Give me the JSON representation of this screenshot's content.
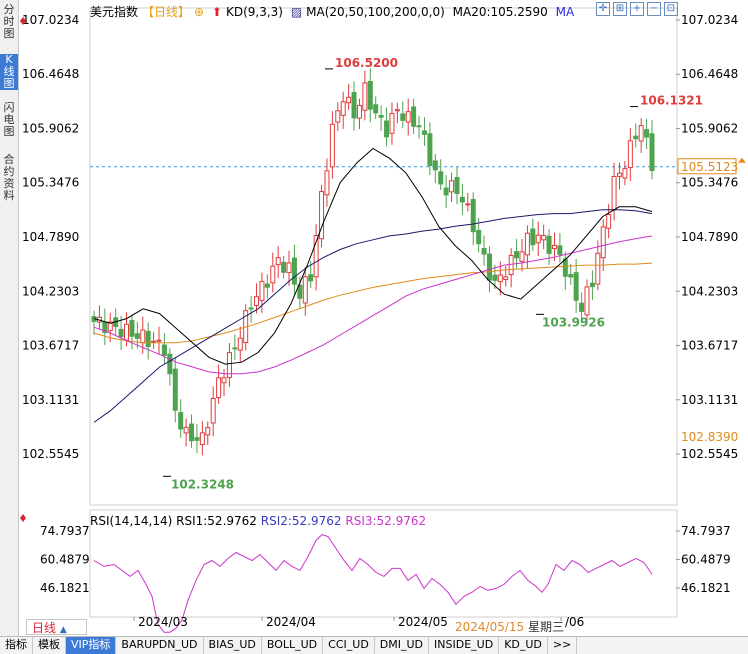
{
  "left_tabs": [
    {
      "label": "分时图",
      "active": false
    },
    {
      "label": "K线图",
      "active": true
    },
    {
      "label": "闪电图",
      "active": false
    },
    {
      "label": "合约资料",
      "active": false
    }
  ],
  "legend": {
    "symbol": "美元指数",
    "period": "【日线】",
    "kd": "KD(9,3,3)",
    "ma": "MA(20,50,100,200,0,0)",
    "ma20_value": "MA20:105.2590",
    "ma_label": "MA"
  },
  "colors": {
    "up": "#e03c3c",
    "down": "#4fa34f",
    "ma20": "#000000",
    "ma50": "#1a1a6e",
    "ma100": "#cc33cc",
    "ma200": "#e08a1a",
    "rsi": "#cc33cc",
    "accent": "#3d7ad6"
  },
  "price_axis": {
    "ticks": [
      "107.0234",
      "106.4648",
      "105.9062",
      "105.3476",
      "104.7890",
      "104.2303",
      "103.6717",
      "103.1131",
      "102.5545"
    ]
  },
  "price_markers": {
    "current": "105.5123",
    "lower_ref": "102.8390"
  },
  "annotations": {
    "high1": "106.5200",
    "high2": "106.1321",
    "low1": "102.3248",
    "low2": "103.9926"
  },
  "rsi": {
    "legend_name": "RSI(14,14,14)",
    "rsi1": "RSI1:52.9762",
    "rsi2": "RSI2:52.9762",
    "rsi3": "RSI3:52.9762",
    "ticks": [
      "74.7937",
      "60.4879",
      "46.1821"
    ]
  },
  "x_axis": {
    "labels": [
      "2024/03",
      "2024/04",
      "2024/05",
      "/06"
    ]
  },
  "period_selector": "日线",
  "cursor_date": {
    "date": "2024/05/15",
    "weekday": "星期三"
  },
  "bottom_tabs": [
    "指标",
    "模板",
    "VIP指标",
    "BARUPDN_UD",
    "BIAS_UD",
    "BOLL_UD",
    "CCI_UD",
    "DMI_UD",
    "INSIDE_UD",
    "KD_UD",
    ">>"
  ],
  "chart_data": {
    "type": "candlestick",
    "symbol": "美元指数",
    "ylim": [
      102.2,
      107.1
    ],
    "series": [
      {
        "name": "MA20",
        "values": [
          104.1,
          104.06,
          104.02,
          103.95,
          103.86,
          103.78,
          103.73,
          103.7,
          103.66,
          103.62,
          103.59,
          103.58,
          103.59,
          103.6,
          103.63,
          103.68,
          103.75,
          103.85,
          103.97,
          104.1,
          104.25,
          104.42,
          104.62,
          104.85,
          105.08,
          105.28,
          105.45,
          105.57,
          105.65,
          105.7,
          105.73,
          105.74,
          105.73,
          105.68,
          105.58,
          105.45,
          105.28,
          105.07,
          104.88,
          104.72,
          104.62,
          104.57,
          104.57,
          104.61,
          104.67,
          104.77,
          104.88,
          105.0,
          105.08,
          105.15,
          105.19,
          105.21,
          105.26
        ]
      },
      {
        "name": "MA50",
        "values": [
          102.9,
          102.98,
          103.06,
          103.14,
          103.21,
          103.28,
          103.36,
          103.43,
          103.51,
          103.58,
          103.65,
          103.72,
          103.78,
          103.84,
          103.91,
          103.97,
          104.03,
          104.09,
          104.15,
          104.22,
          104.29,
          104.36,
          104.43,
          104.5,
          104.57,
          104.63,
          104.69,
          104.74,
          104.79,
          104.83,
          104.87,
          104.9,
          104.93,
          104.96,
          104.98,
          104.99,
          105.0,
          105.0,
          105.0,
          105.01,
          105.03,
          105.04,
          105.05,
          105.05,
          105.06,
          105.08,
          105.1,
          105.11,
          105.13,
          105.14,
          105.14,
          105.15,
          105.14
        ]
      }
    ],
    "rsi_series": [
      {
        "name": "RSI1",
        "last": 52.9762
      }
    ]
  }
}
